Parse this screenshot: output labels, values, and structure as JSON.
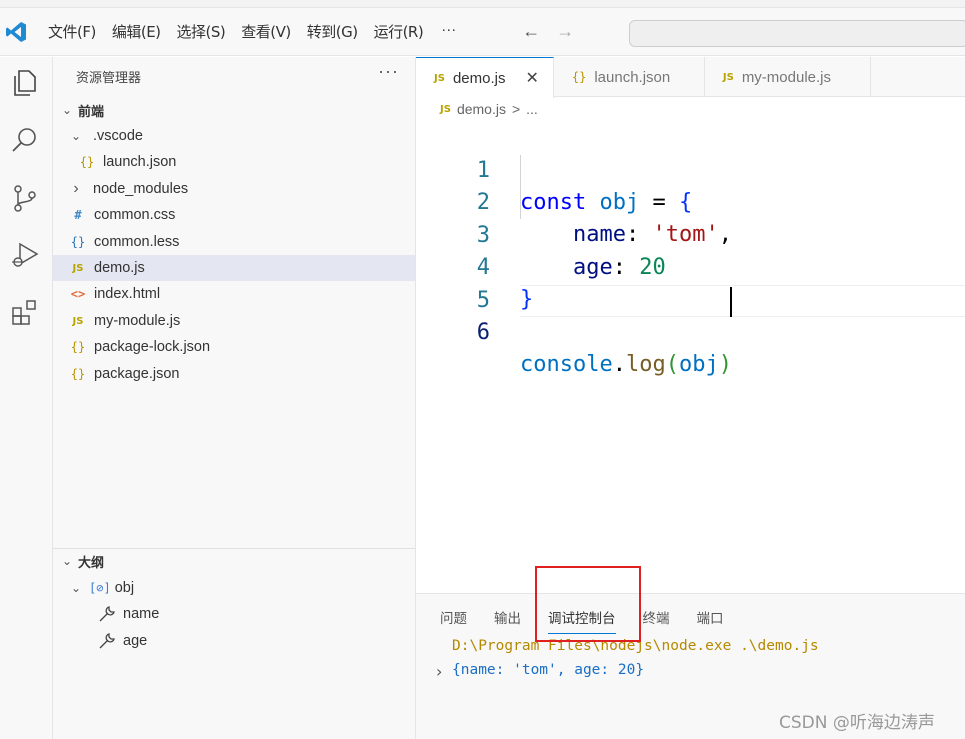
{
  "menu": [
    "文件(F)",
    "编辑(E)",
    "选择(S)",
    "查看(V)",
    "转到(G)",
    "运行(R)"
  ],
  "menu_more": "···",
  "nav": {
    "back": "←",
    "forward": "→"
  },
  "explorer": {
    "title": "资源管理器",
    "more": "···",
    "folder": "前端",
    "items": [
      {
        "label": ".vscode",
        "chevron": "⌄",
        "icon": ""
      },
      {
        "label": "launch.json",
        "icon": "{}"
      },
      {
        "label": "node_modules",
        "chevron": "›",
        "icon": ""
      },
      {
        "label": "common.css",
        "icon": "#"
      },
      {
        "label": "common.less",
        "icon": "{}"
      },
      {
        "label": "demo.js",
        "icon": "JS"
      },
      {
        "label": "index.html",
        "icon": "<>"
      },
      {
        "label": "my-module.js",
        "icon": "JS"
      },
      {
        "label": "package-lock.json",
        "icon": "{}"
      },
      {
        "label": "package.json",
        "icon": "{}"
      }
    ]
  },
  "outline": {
    "title": "大纲",
    "root": "obj",
    "root_icon": "[⊘]",
    "children": [
      "name",
      "age"
    ]
  },
  "tabs": [
    {
      "label": "demo.js",
      "icon": "JS",
      "close": "✕"
    },
    {
      "label": "launch.json",
      "icon": "{}"
    },
    {
      "label": "my-module.js",
      "icon": "JS"
    }
  ],
  "breadcrumb": {
    "icon": "JS",
    "file": "demo.js",
    "sep": ">",
    "rest": "..."
  },
  "editor": {
    "line_numbers": [
      "1",
      "2",
      "3",
      "4",
      "5",
      "6"
    ],
    "l1": {
      "kw": "const",
      "var": "obj",
      "rest": " = ",
      "brace": "{"
    },
    "l2": {
      "prop": "name",
      "colon": ": ",
      "str": "'tom'",
      "comma": ","
    },
    "l3": {
      "prop": "age",
      "colon": ": ",
      "num": "20"
    },
    "l4": {
      "brace": "}"
    },
    "l6": {
      "obj": "console",
      "dot": ".",
      "fn": "log",
      "open": "(",
      "arg": "obj",
      "close": ")"
    }
  },
  "panel": {
    "tabs": [
      "问题",
      "输出",
      "调试控制台",
      "终端",
      "端口"
    ],
    "console_cmd": "D:\\Program Files\\nodejs\\node.exe .\\demo.js",
    "console_chevron": "›",
    "console_result": "{name: 'tom', age: 20}"
  },
  "watermark": "CSDN @听海边涛声",
  "colors": {
    "accent": "#0078d4",
    "highlight_box": "#e02020",
    "selected_row": "#e4e6f1"
  }
}
